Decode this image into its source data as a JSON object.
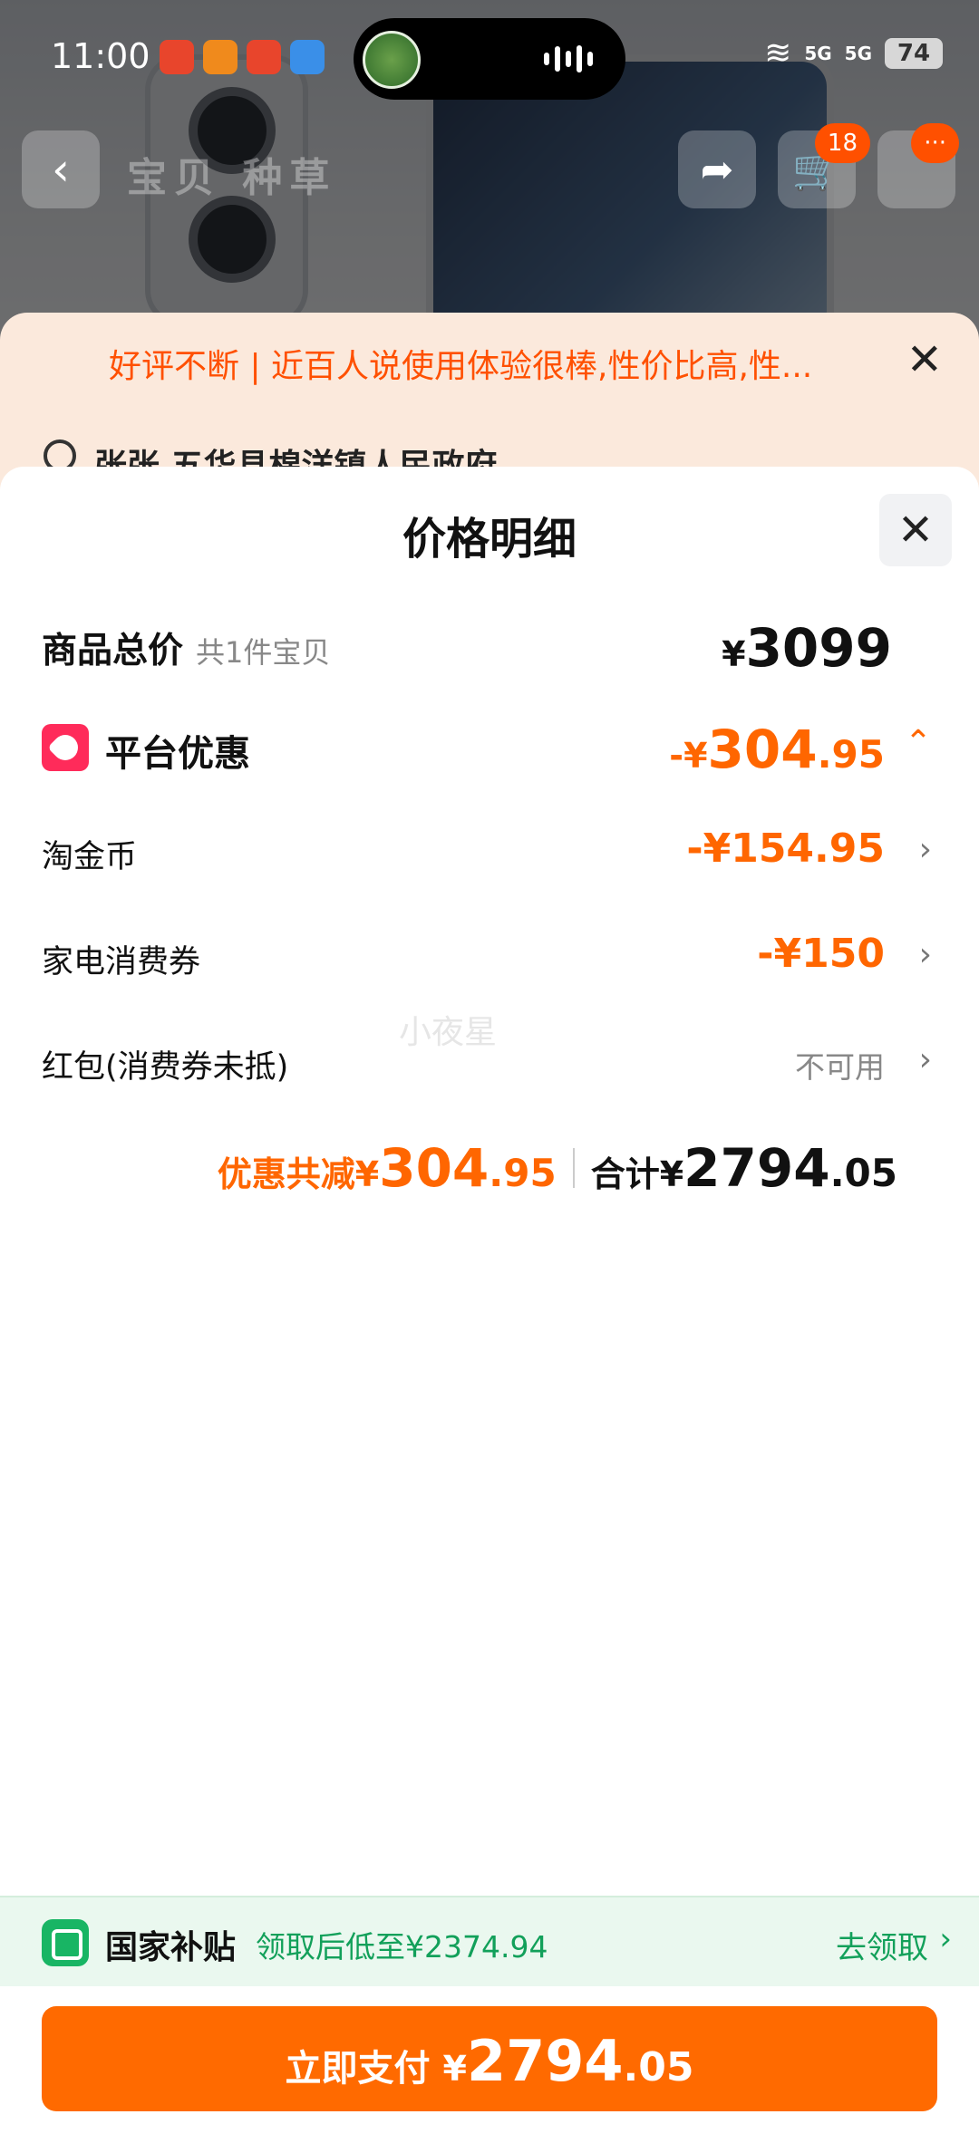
{
  "status_bar": {
    "time": "11:00",
    "network1": "5G",
    "network2": "5G",
    "battery": "74"
  },
  "nav": {
    "tabs_text": "宝贝 种草",
    "cart_badge": "18",
    "more_badge": "···"
  },
  "notice": {
    "text": "好评不断 | 近百人说使用体验很棒,性价比高,性..."
  },
  "address": {
    "text": "张张 五华县棉洋镇人民政府"
  },
  "sheet": {
    "title": "价格明细",
    "goods_total": {
      "label": "商品总价",
      "sub": "共1件宝贝",
      "yen": "¥",
      "amount": "3099"
    },
    "platform_discount": {
      "label": "平台优惠",
      "prefix": "-¥",
      "amount_int": "304",
      "amount_dec": ".95"
    },
    "items": [
      {
        "label": "淘金币",
        "value": "-¥154.95"
      },
      {
        "label": "家电消费券",
        "value": "-¥150"
      },
      {
        "label": "红包(消费券未抵)",
        "value": "不可用"
      }
    ],
    "summary": {
      "discount_label": "优惠共减¥",
      "discount_int": "304",
      "discount_dec": ".95",
      "total_label": "合计¥",
      "total_int": "2794",
      "total_dec": ".05"
    },
    "watermark": "小夜星"
  },
  "subsidy": {
    "name": "国家补贴",
    "desc": "领取后低至¥2374.94",
    "action": "去领取"
  },
  "pay_button": {
    "label": "立即支付",
    "yen": "¥",
    "amount_int": "2794",
    "amount_dec": ".05"
  }
}
